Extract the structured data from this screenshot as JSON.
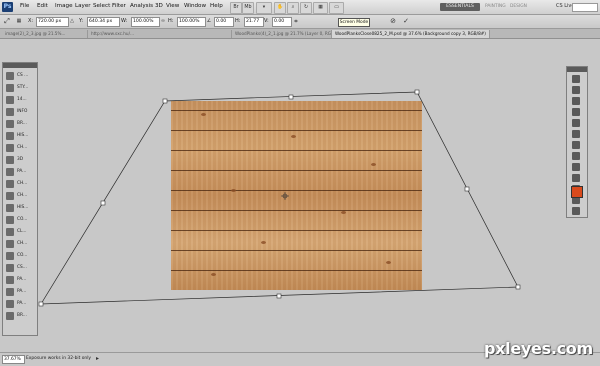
{
  "app": {
    "logo": "Ps"
  },
  "menu": [
    "File",
    "Edit",
    "Image",
    "Layer",
    "Select",
    "Filter",
    "Analysis",
    "3D",
    "View",
    "Window",
    "Help"
  ],
  "workspace": {
    "active": "ESSENTIALS",
    "others": [
      "PAINTING",
      "DESIGN"
    ]
  },
  "cs_live": "CS Live",
  "options": {
    "x_label": "X:",
    "x_value": "720.00 px",
    "y_label": "Y:",
    "y_value": "640.34 px",
    "w_label": "W:",
    "w_value": "100.00%",
    "h_label": "H:",
    "h_value": "100.00%",
    "angle_value": "0.00",
    "h_skew_label": "H:",
    "h_skew_value": "21.77",
    "v_skew_label": "V:",
    "v_skew_value": "0.00",
    "tooltip": "Screen Mode"
  },
  "tabs": [
    "image(2)_2_3.jpg @ 21.5%...",
    "http://www.sxc.hu/...",
    "WoodPlanks(4)_2_1.jpg @ 21.7% (Layer 0, RGB/8)",
    "WoodPlanksClose0825_2_M.psd @ 37.6% (Background copy 3, RGB/8#)"
  ],
  "tools_left": [
    "CS ...",
    "STY...",
    "14...",
    "INFO",
    "BR...",
    "HIS...",
    "CH...",
    "3D",
    "PA...",
    "CH...",
    "CH...",
    "HIS...",
    "CO...",
    "CL...",
    "CH...",
    "CO...",
    "CS...",
    "PA...",
    "PA...",
    "PA...",
    "BR..."
  ],
  "status": {
    "zoom": "37.67%",
    "message": "Exposure works in 32-bit only"
  },
  "colors": {
    "foreground": "#d94a1c",
    "background": "#ffffff"
  },
  "watermark": "pxleyes.com"
}
